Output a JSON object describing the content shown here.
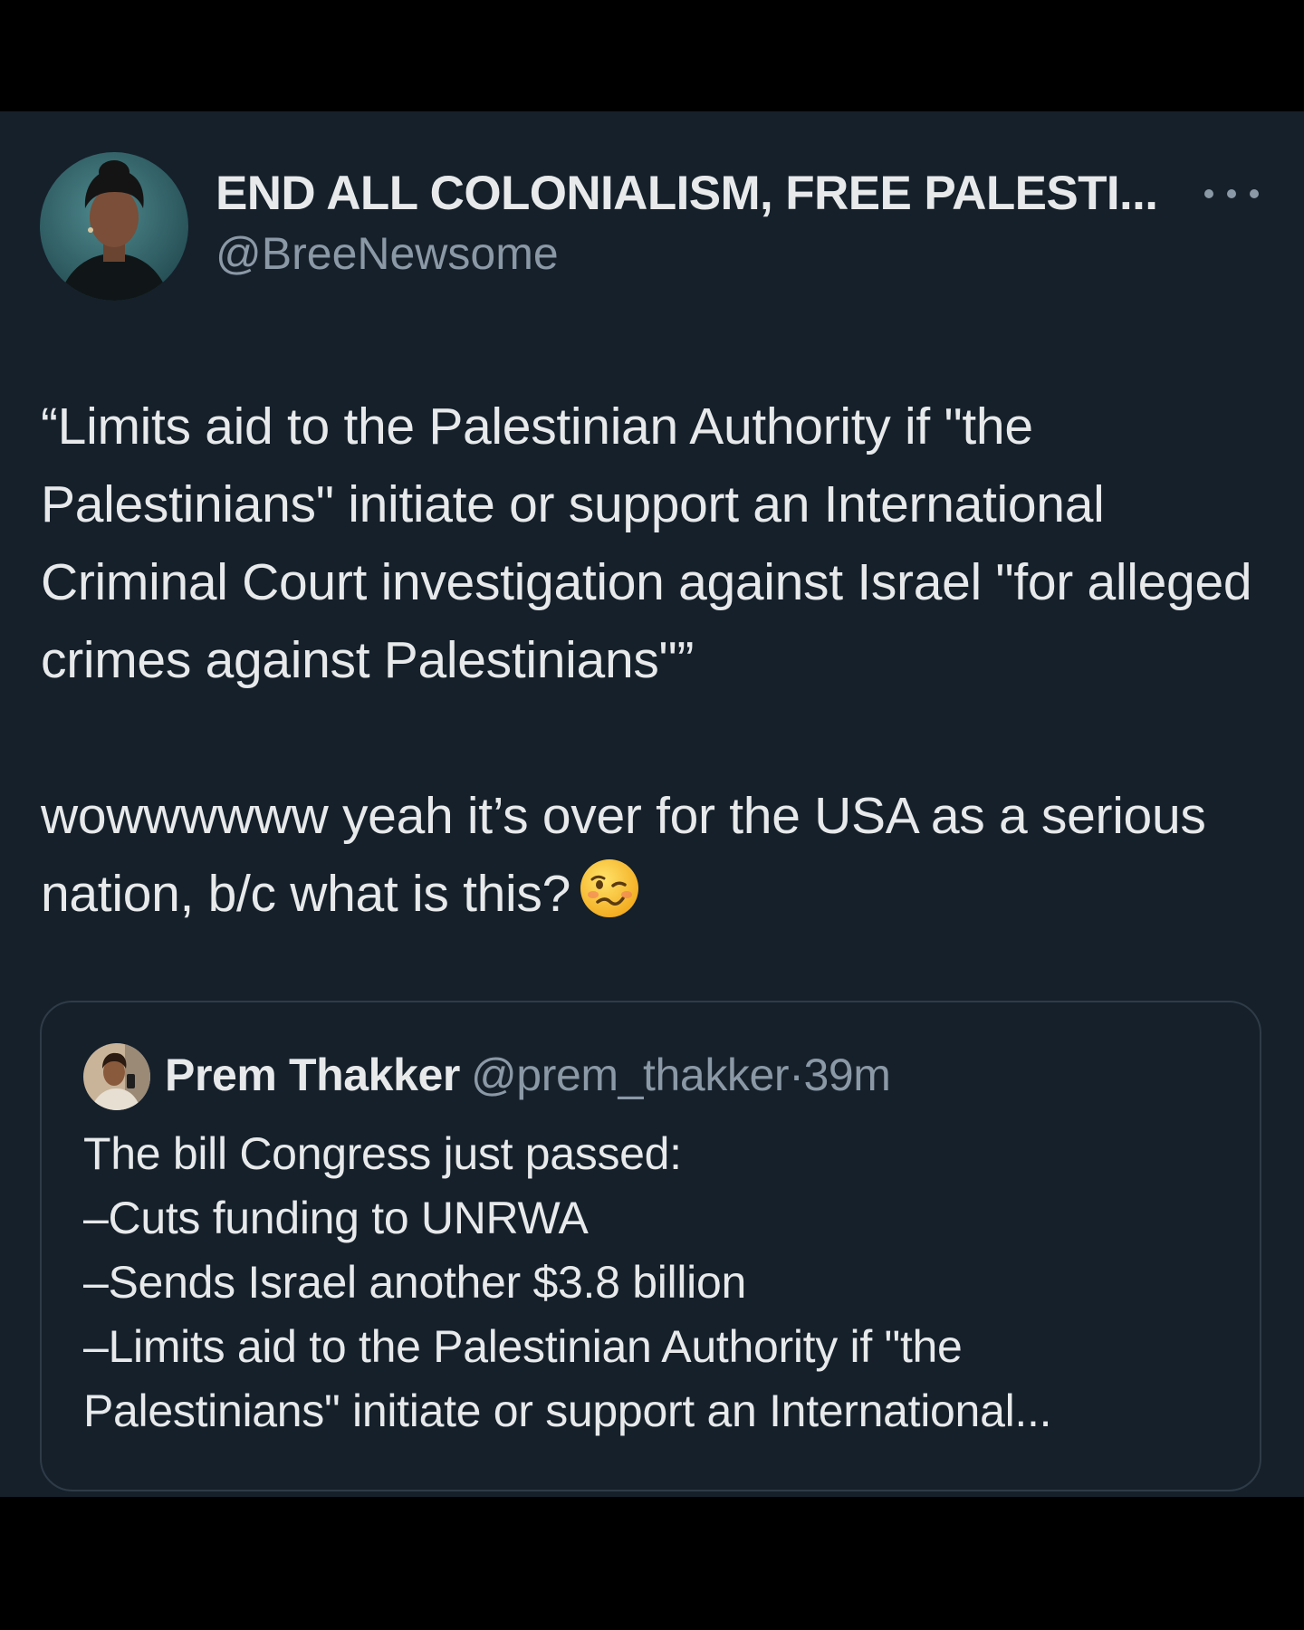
{
  "tweet": {
    "author": {
      "display_name": "END ALL COLONIALISM, FREE PALESTI...",
      "handle": "@BreeNewsome"
    },
    "more_icon": "more-horizontal-icon",
    "quote_paragraph": "“Limits aid to the Palestinian Authority if \"the Palestinians\" initiate or support an International Criminal Court investigation against Israel \"for alleged crimes against Palestinians\"”",
    "comment_paragraph": "wowwwwww yeah it’s over for the USA as a serious nation, b/c what is this?",
    "emoji": "woozy-face-emoji"
  },
  "quoted_tweet": {
    "display_name": "Prem Thakker",
    "handle": "@prem_thakker",
    "separator": "·",
    "time": "39m",
    "lines": [
      "The bill Congress just passed:",
      "–Cuts funding to UNRWA",
      "–Sends Israel another $3.8 billion",
      "–Limits aid to the Palestinian Authority if \"the",
      "Palestinians\" initiate or support an International..."
    ]
  },
  "colors": {
    "background": "#15202b",
    "text": "#e7e9ea",
    "secondary_text": "#8b98a5",
    "border": "#2f3b47",
    "outer": "#000000"
  }
}
